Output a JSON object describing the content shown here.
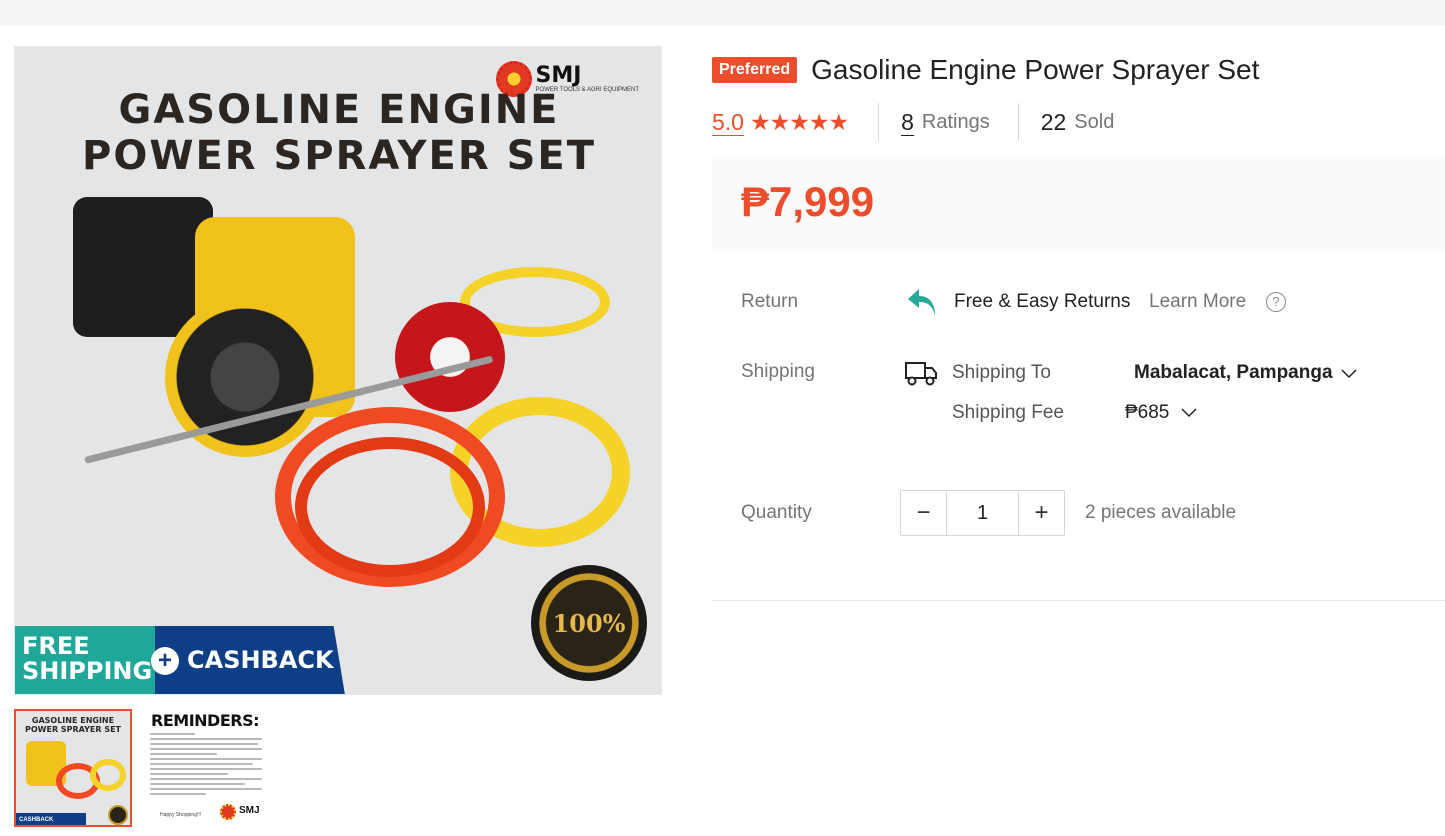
{
  "product_image": {
    "heading_line1": "GASOLINE ENGINE",
    "heading_line2": "POWER SPRAYER SET",
    "logo_name": "SMJ",
    "logo_sub": "POWER TOOLS & AGRI EQUIPMENT",
    "seal_text": "100%",
    "banner_left_line1": "FREE",
    "banner_left_line2": "SHIPPING",
    "banner_right": "CASHBACK"
  },
  "thumbnails": {
    "first_title_line1": "GASOLINE ENGINE",
    "first_title_line2": "POWER SPRAYER SET",
    "first_banner": "CASHBACK",
    "second_title": "REMINDERS:",
    "second_footer": "Happy Shopping!!!",
    "second_logo": "SMJ"
  },
  "product": {
    "badge": "Preferred",
    "title": "Gasoline Engine Power Sprayer Set",
    "rating": "5.0",
    "stars": "★★★★★",
    "ratings_count": "8",
    "ratings_label": "Ratings",
    "sold_count": "22",
    "sold_label": "Sold",
    "price": "₱7,999"
  },
  "return": {
    "label": "Return",
    "text": "Free & Easy Returns",
    "learn_more": "Learn More",
    "help": "?"
  },
  "shipping": {
    "label": "Shipping",
    "to_label": "Shipping To",
    "to_value": "Mabalacat, Pampanga",
    "fee_label": "Shipping Fee",
    "fee_value": "₱685"
  },
  "quantity": {
    "label": "Quantity",
    "minus": "−",
    "value": "1",
    "plus": "+",
    "available": "2 pieces available"
  },
  "colors": {
    "accent": "#ee4d2d",
    "return_icon": "#26aa99"
  },
  "icons": {
    "return": "return-arrow-icon",
    "truck": "truck-icon",
    "chevron": "chevron-down-icon",
    "help": "question-circle-icon"
  }
}
